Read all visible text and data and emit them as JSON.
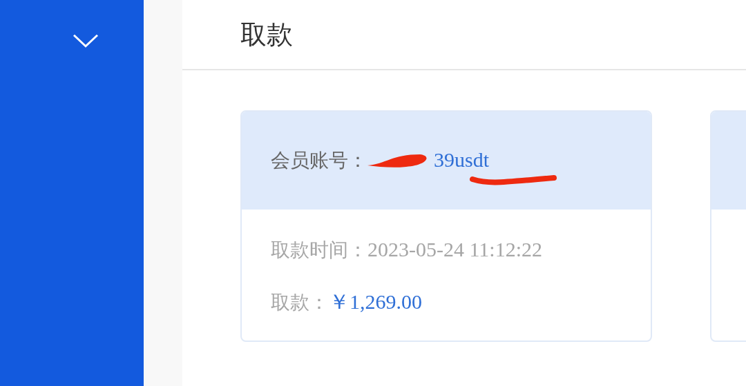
{
  "page": {
    "title": "取款"
  },
  "records": [
    {
      "account_label": "会员账号：",
      "account": "39usdt",
      "time_label": "取款时间：",
      "time": "2023-05-24 11:12:22",
      "amount_label": "取款：",
      "amount": "￥1,269.00"
    }
  ]
}
